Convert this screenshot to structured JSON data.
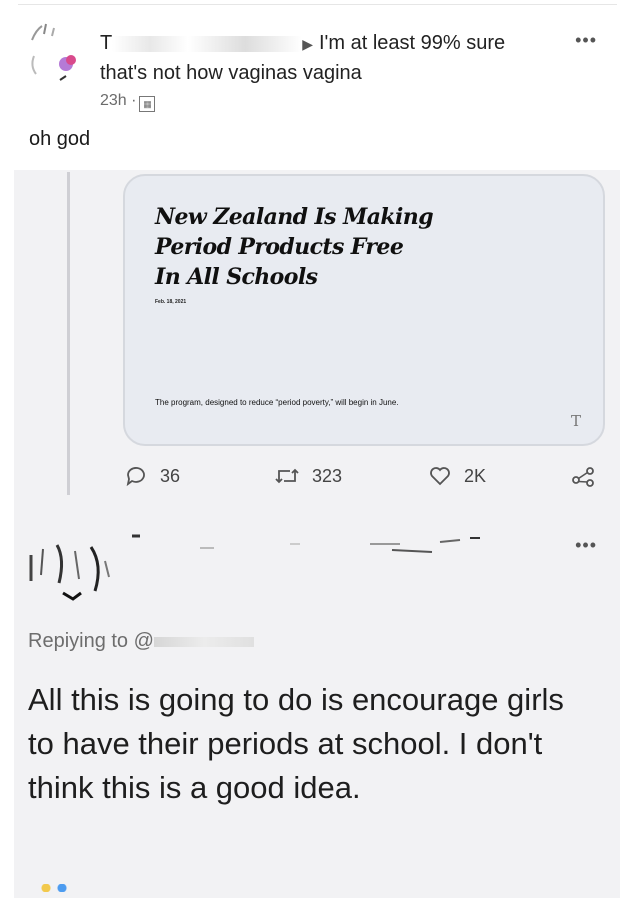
{
  "top_comment": {
    "name_initial": "T",
    "text_line1": "I'm at least 99% sure",
    "text_line2": "that's not how vaginas vagina",
    "time": "23h ·",
    "reply_text": "oh god"
  },
  "article_card": {
    "headline_lines": [
      "New Zealand Is Making",
      "Period Products Free",
      "In All Schools"
    ],
    "date": "Feb. 18, 2021",
    "summary": "The program, designed to reduce “period poverty,” will begin in June.",
    "source_mark": "T"
  },
  "actions": {
    "replies": "36",
    "retweets": "323",
    "likes": "2K"
  },
  "reply": {
    "replying_prefix": "Repiying to @",
    "body": "All this is going to do is encourage girls to have their periods at school. I don't think this is a good idea."
  }
}
